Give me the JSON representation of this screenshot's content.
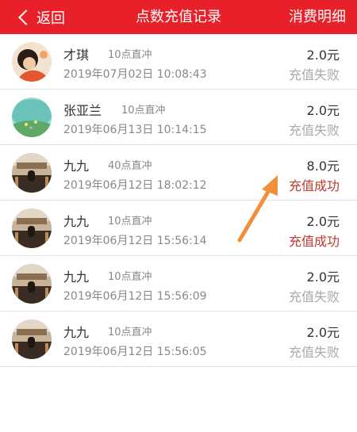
{
  "header": {
    "back_label": "返回",
    "title": "点数充值记录",
    "detail_label": "消费明细",
    "bg_color": "#e8202a"
  },
  "records": [
    {
      "name": "才琪",
      "tag": "10点直冲",
      "time": "2019年07月02日 10:08:43",
      "amount": "2.0元",
      "status": "充值失败",
      "status_color": "#aaaaaa",
      "avatar": "girl"
    },
    {
      "name": "张亚兰",
      "tag": "10点直冲",
      "time": "2019年06月13日 10:14:15",
      "amount": "2.0元",
      "status": "充值失败",
      "status_color": "#aaaaaa",
      "avatar": "teal"
    },
    {
      "name": "九九",
      "tag": "40点直冲",
      "time": "2019年06月12日 18:02:12",
      "amount": "8.0元",
      "status": "充值成功",
      "status_color": "#c0392b",
      "avatar": "room"
    },
    {
      "name": "九九",
      "tag": "10点直冲",
      "time": "2019年06月12日 15:56:14",
      "amount": "2.0元",
      "status": "充值成功",
      "status_color": "#c0392b",
      "avatar": "room"
    },
    {
      "name": "九九",
      "tag": "10点直冲",
      "time": "2019年06月12日 15:56:09",
      "amount": "2.0元",
      "status": "充值失败",
      "status_color": "#aaaaaa",
      "avatar": "room"
    },
    {
      "name": "九九",
      "tag": "10点直冲",
      "time": "2019年06月12日 15:56:05",
      "amount": "2.0元",
      "status": "充值失败",
      "status_color": "#aaaaaa",
      "avatar": "room"
    }
  ],
  "annotation": {
    "color": "#f0903a"
  }
}
